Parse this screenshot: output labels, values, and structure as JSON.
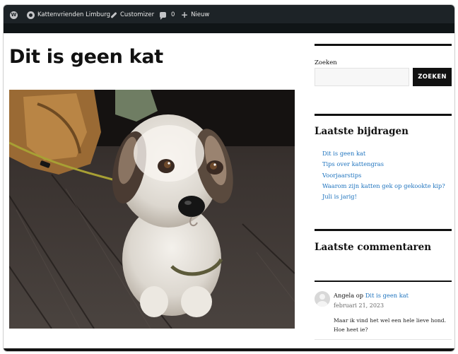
{
  "adminbar": {
    "site_name": "Kattenvrienden Limburg",
    "customizer": "Customizer",
    "comments_count": "0",
    "new_label": "Nieuw"
  },
  "post": {
    "title": "Dit is geen kat"
  },
  "sidebar": {
    "search": {
      "label": "Zoeken",
      "value": "",
      "placeholder": "",
      "button": "ZOEKEN"
    },
    "recent_posts": {
      "title": "Laatste bijdragen",
      "items": [
        "Dit is geen kat",
        "Tips over kattengras",
        "Voorjaarstips",
        "Waarom zijn katten gek op gekookte kip?",
        "Juli is jarig!"
      ]
    },
    "recent_comments": {
      "title": "Laatste commentaren",
      "author": "Angela",
      "on_word": " op ",
      "post_link": "Dit is geen kat",
      "date": "februari 21, 2023",
      "text": "Maar ik vind het wel een hele lieve hond. Hoe heet ie?"
    }
  },
  "colors": {
    "adminbar": "#1d2327",
    "link": "#1e73be",
    "button": "#111111"
  }
}
